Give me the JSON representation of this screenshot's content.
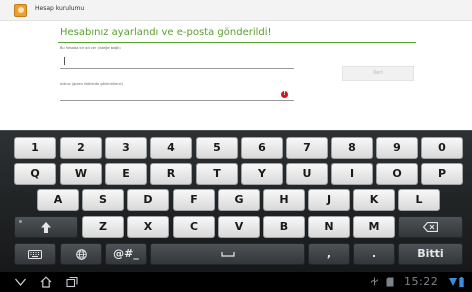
{
  "window": {
    "title": "Hesap kurulumu",
    "icon": "account-setup-icon"
  },
  "setup": {
    "headline": "Hesabınız ayarlandı ve e-posta gönderildi!",
    "name_label": "Bu hesaba bir ad ver (isteğe bağlı)",
    "name_value": "",
    "display_name_label": "Adınız (giden iletilerde görüntülenir)",
    "display_name_value": "",
    "next_button": "İleri",
    "error_icon": "error-icon",
    "accent_color": "#5aa02c",
    "error_color": "#d0161d"
  },
  "keyboard": {
    "row1": [
      "1",
      "2",
      "3",
      "4",
      "5",
      "6",
      "7",
      "8",
      "9",
      "0"
    ],
    "row2": [
      "Q",
      "W",
      "E",
      "R",
      "T",
      "Y",
      "U",
      "I",
      "O",
      "P"
    ],
    "row3": [
      "A",
      "S",
      "D",
      "F",
      "G",
      "H",
      "J",
      "K",
      "L"
    ],
    "row4": [
      "Z",
      "X",
      "C",
      "V",
      "B",
      "N",
      "M"
    ],
    "symbols_key": "@#_",
    "comma_key": ",",
    "period_key": ".",
    "done_key": "Bitti",
    "icons": {
      "shift": "shift-arrow-icon",
      "backspace": "backspace-icon",
      "settings": "keyboard-settings-icon",
      "language": "globe-icon",
      "space": "space-bar-icon"
    }
  },
  "system_bar": {
    "clock": "15:22",
    "icons": [
      "back-icon",
      "home-icon",
      "recent-apps-icon",
      "usb-icon",
      "sd-card-icon",
      "wifi-icon",
      "battery-icon"
    ]
  }
}
